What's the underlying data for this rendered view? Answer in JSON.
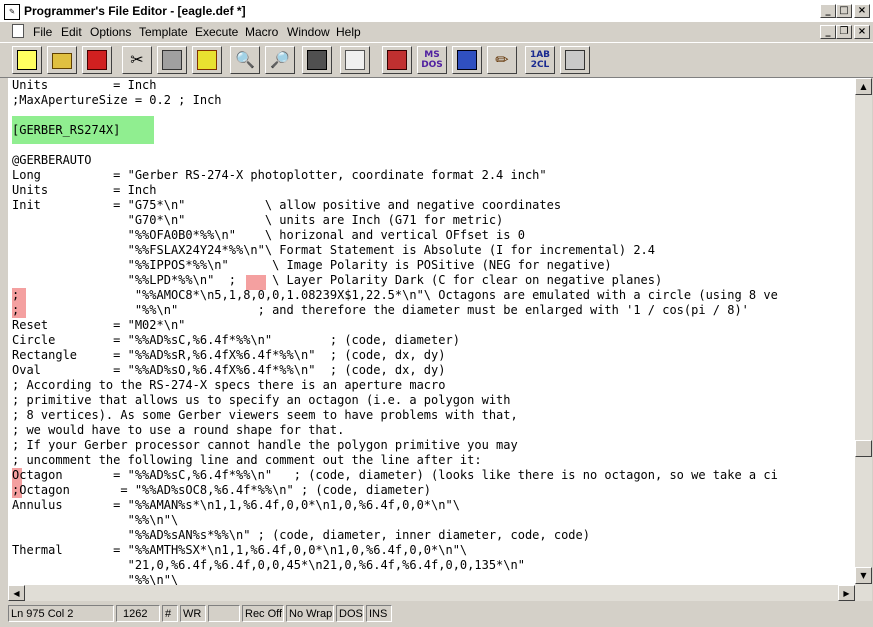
{
  "window": {
    "title": "Programmer's File Editor - [eagle.def *]"
  },
  "menu": [
    "File",
    "Edit",
    "Options",
    "Template",
    "Execute",
    "Macro",
    "Window",
    "Help"
  ],
  "toolbar": {
    "buttons": [
      {
        "name": "new-file-icon"
      },
      {
        "name": "open-folder-icon"
      },
      {
        "name": "save-icon"
      },
      {
        "name": "cut-icon"
      },
      {
        "name": "copy-icon"
      },
      {
        "name": "paste-icon"
      },
      {
        "name": "find-icon"
      },
      {
        "name": "find-next-icon"
      },
      {
        "name": "execute-icon"
      },
      {
        "name": "template-icon"
      },
      {
        "name": "macro-record-icon"
      },
      {
        "name": "ms-dos-icon",
        "label": "MS DOS"
      },
      {
        "name": "calculator-icon"
      },
      {
        "name": "tools-icon"
      },
      {
        "name": "case-convert-icon",
        "label": "1AB 2CL"
      },
      {
        "name": "print-icon"
      }
    ]
  },
  "editor": {
    "lines": [
      "Units         = Inch",
      ";MaxApertureSize = 0.2 ; Inch",
      "",
      "[GERBER_RS274X]",
      "",
      "@GERBERAUTO",
      "Long          = \"Gerber RS-274-X photoplotter, coordinate format 2.4 inch\"",
      "Units         = Inch",
      "Init          = \"G75*\\n\"           \\ allow positive and negative coordinates",
      "                \"G70*\\n\"           \\ units are Inch (G71 for metric)",
      "                \"%%OFA0B0*%%\\n\"    \\ horizonal and vertical OFfset is 0",
      "                \"%%FSLAX24Y24*%%\\n\"\\ Format Statement is Absolute (I for incremental) 2.4",
      "                \"%%IPPOS*%%\\n\"      \\ Image Polarity is POSitive (NEG for negative)",
      "                \"%%LPD*%%\\n\"  ;     \\ Layer Polarity Dark (C for clear on negative planes)",
      ";                \"%%AMOC8*\\n5,1,8,0,0,1.08239X$1,22.5*\\n\"\\ Octagons are emulated with a circle (using 8 ve",
      ";                \"%%\\n\"           ; and therefore the diameter must be enlarged with '1 / cos(pi / 8)'",
      "Reset         = \"M02*\\n\"",
      "Circle        = \"%%AD%sC,%6.4f*%%\\n\"        ; (code, diameter)",
      "Rectangle     = \"%%AD%sR,%6.4fX%6.4f*%%\\n\"  ; (code, dx, dy)",
      "Oval          = \"%%AD%sO,%6.4fX%6.4f*%%\\n\"  ; (code, dx, dy)",
      "; According to the RS-274-X specs there is an aperture macro",
      "; primitive that allows us to specify an octagon (i.e. a polygon with",
      "; 8 vertices). As some Gerber viewers seem to have problems with that,",
      "; we would have to use a round shape for that.",
      "; If your Gerber processor cannot handle the polygon primitive you may",
      "; uncomment the following line and comment out the line after it:",
      "Octagon       = \"%%AD%sC,%6.4f*%%\\n\"   ; (code, diameter) (looks like there is no octagon, so we take a ci",
      ";Octagon       = \"%%AD%sOC8,%6.4f*%%\\n\" ; (code, diameter)",
      "Annulus       = \"%%AMAN%s*\\n1,1,%6.4f,0,0*\\n1,0,%6.4f,0,0*\\n\"\\",
      "                \"%%\\n\"\\",
      "                \"%%AD%sAN%s*%%\\n\" ; (code, diameter, inner diameter, code, code)",
      "Thermal       = \"%%AMTH%SX*\\n1,1,%6.4f,0,0*\\n1,0,%6.4f,0,0*\\n\"\\",
      "                \"21,0,%6.4f,%6.4f,0,0,45*\\n21,0,%6.4f,%6.4f,0,0,135*\\n\"",
      "                \"%%\\n\"\\"
    ]
  },
  "status": {
    "position": "Ln 975 Col 2",
    "count": "1262",
    "hash": "#",
    "wr": "WR",
    "blank": "",
    "rec": "Rec Off",
    "wrap": "No Wrap",
    "dos": "DOS",
    "ins": "INS"
  },
  "colors": {
    "section_highlight": "#90ee90",
    "marker_highlight": "#f4a0a0"
  }
}
